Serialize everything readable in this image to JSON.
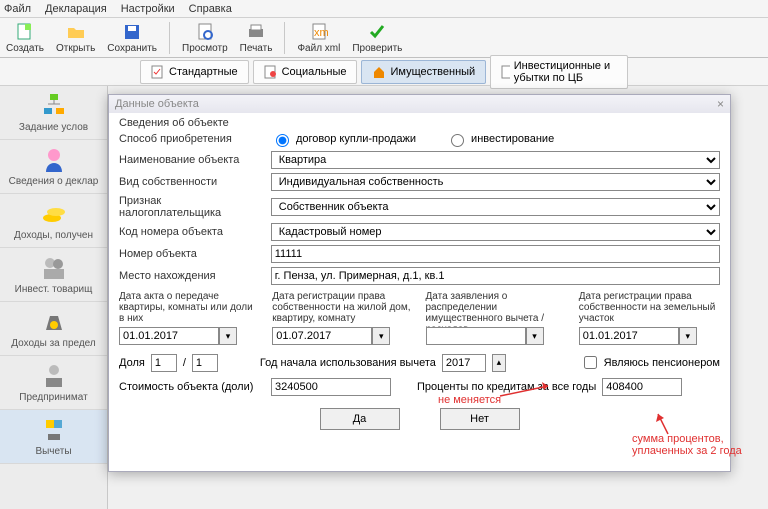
{
  "menu": {
    "file": "Файл",
    "decl": "Декларация",
    "settings": "Настройки",
    "help": "Справка"
  },
  "toolbar": {
    "create": "Создать",
    "open": "Открыть",
    "save": "Сохранить",
    "preview": "Просмотр",
    "print": "Печать",
    "filexml": "Файл xml",
    "check": "Проверить"
  },
  "tabs": {
    "standard": "Стандартные",
    "social": "Социальные",
    "property": "Имущественный",
    "invest": "Инвестиционные и убытки по ЦБ"
  },
  "sidebar": {
    "cond": "Задание услов",
    "decl": "Сведения о деклар",
    "income": "Доходы, получен",
    "invest": "Инвест. товарищ",
    "abroad": "Доходы за предел",
    "entrep": "Предпринимат",
    "deduct": "Вычеты"
  },
  "modal": {
    "title": "Данные объекта",
    "section": "Сведения об объекте",
    "acq_method": "Способ приобретения",
    "acq_opt1": "договор купли-продажи",
    "acq_opt2": "инвестирование",
    "obj_name_lbl": "Наименование объекта",
    "obj_name_val": "Квартира",
    "own_type_lbl": "Вид собственности",
    "own_type_val": "Индивидуальная собственность",
    "taxpayer_lbl": "Признак налогоплательщика",
    "taxpayer_val": "Собственник объекта",
    "codenum_lbl": "Код номера объекта",
    "codenum_val": "Кадастровый номер",
    "objnum_lbl": "Номер объекта",
    "objnum_val": "11111",
    "loc_lbl": "Место нахождения",
    "loc_val": "г. Пенза, ул. Примерная, д.1, кв.1",
    "date1_lbl": "Дата акта о передаче квартиры, комнаты или доли в них",
    "date1_val": "01.01.2017",
    "date2_lbl": "Дата регистрации права собственности на жилой дом, квартиру, комнату",
    "date2_val": "01.07.2017",
    "date3_lbl": "Дата заявления о распределении имущественного вычета / расходов",
    "date3_val": "",
    "date4_lbl": "Дата регистрации права собственности на земельный участок",
    "date4_val": "01.01.2017",
    "share_lbl": "Доля",
    "share_num": "1",
    "share_den": "1",
    "year_lbl": "Год начала использования вычета",
    "year_val": "2017",
    "pension_lbl": "Являюсь пенсионером",
    "cost_lbl": "Стоимость объекта (доли)",
    "cost_val": "3240500",
    "interest_lbl": "Проценты по кредитам за все годы",
    "interest_val": "408400",
    "btn_yes": "Да",
    "btn_no": "Нет"
  },
  "annotations": {
    "no_change": "не меняется",
    "sum_interest": "сумма процентов, уплаченных за 2 года"
  }
}
